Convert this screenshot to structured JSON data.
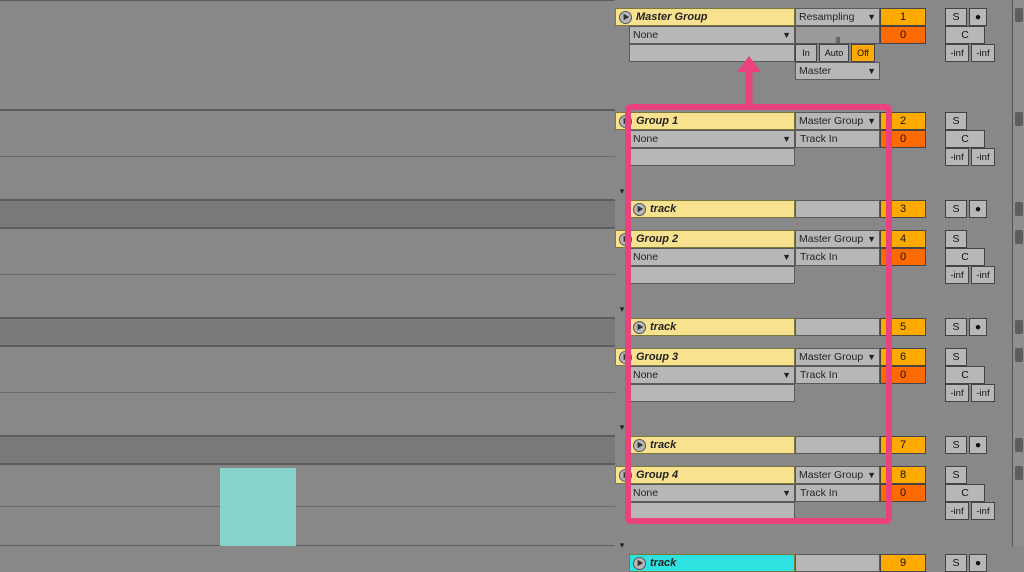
{
  "masterGroup": {
    "name": "Master Group",
    "midi_from": "None",
    "routing": "Resampling",
    "monitor_in": "In",
    "monitor_auto": "Auto",
    "monitor_off": "Off",
    "output": "Master",
    "num": "1",
    "zero": "0",
    "solo": "S",
    "cue": "C",
    "rec": "●",
    "ninf": "-inf"
  },
  "groups": [
    {
      "name": "Group 1",
      "midi_from": "None",
      "routing": "Master Group",
      "input": "Track In",
      "num": "2",
      "zero": "0",
      "solo": "S",
      "cue": "C",
      "ninf": "-inf",
      "track": {
        "name": "track",
        "num": "3",
        "solo": "S",
        "rec": "●"
      }
    },
    {
      "name": "Group 2",
      "midi_from": "None",
      "routing": "Master Group",
      "input": "Track In",
      "num": "4",
      "zero": "0",
      "solo": "S",
      "cue": "C",
      "ninf": "-inf",
      "track": {
        "name": "track",
        "num": "5",
        "solo": "S",
        "rec": "●"
      }
    },
    {
      "name": "Group 3",
      "midi_from": "None",
      "routing": "Master Group",
      "input": "Track In",
      "num": "6",
      "zero": "0",
      "solo": "S",
      "cue": "C",
      "ninf": "-inf",
      "track": {
        "name": "track",
        "num": "7",
        "solo": "S",
        "rec": "●"
      }
    },
    {
      "name": "Group 4",
      "midi_from": "None",
      "routing": "Master Group",
      "input": "Track In",
      "num": "8",
      "zero": "0",
      "solo": "S",
      "cue": "C",
      "ninf": "-inf",
      "track": {
        "name": "track",
        "num": "9",
        "solo": "S",
        "rec": "●",
        "cyan": true
      }
    }
  ]
}
